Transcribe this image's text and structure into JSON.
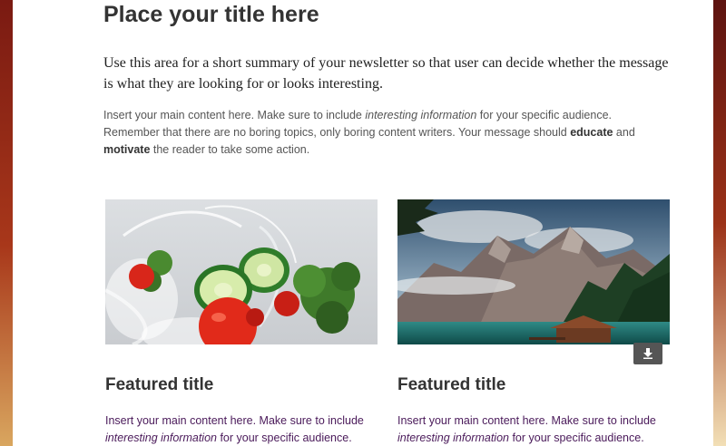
{
  "header": {
    "title": "Place your title here"
  },
  "summary": {
    "text": "Use this area for a short summary of your newsletter so that user can decide whether the message is what they are looking for or looks interesting."
  },
  "main": {
    "part1": "Insert your main content here. Make sure to include ",
    "italic": "interesting information",
    "part2": " for your specific audience. Remember that there are no boring topics, only boring content writers. Your message should ",
    "bold1": "educate",
    "part3": " and ",
    "bold2": "motivate",
    "part4": " the reader to take some action."
  },
  "cards": [
    {
      "title": "Featured title",
      "text_part1": "Insert your main content here. Make sure to include ",
      "text_italic": "interesting information",
      "text_part2": " for your specific audience."
    },
    {
      "title": "Featured title",
      "text_part1": "Insert your main content here. Make sure to include ",
      "text_italic": "interesting information",
      "text_part2": " for your specific audience."
    }
  ],
  "icons": {
    "download": "download-icon"
  },
  "colors": {
    "heading": "#333333",
    "body": "#555555",
    "card_text": "#4a1a5a",
    "button": "#555555"
  }
}
